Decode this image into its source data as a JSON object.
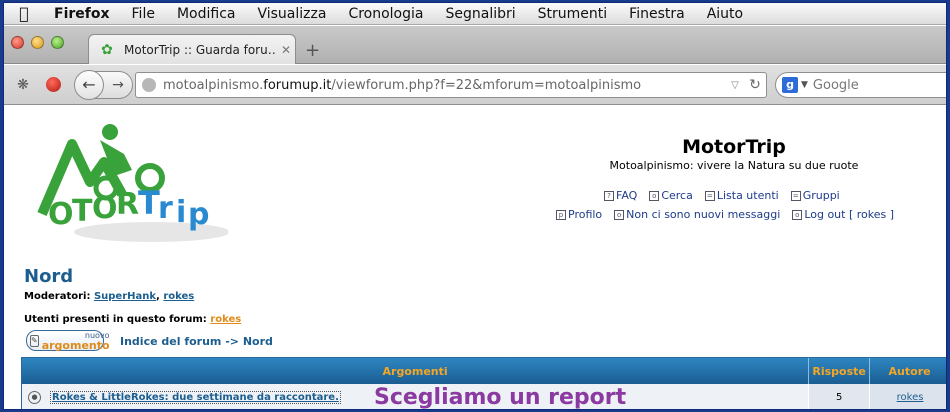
{
  "menubar": {
    "items": [
      "Firefox",
      "File",
      "Modifica",
      "Visualizza",
      "Cronologia",
      "Segnalibri",
      "Strumenti",
      "Finestra",
      "Aiuto"
    ]
  },
  "tab": {
    "title": "MotorTrip :: Guarda foru…",
    "close": "✕",
    "new": "+"
  },
  "nav": {
    "url_prefix": "motoalpinismo.",
    "url_domain": "forumup.it",
    "url_path": "/viewforum.php?f=22&mforum=motoalpinismo",
    "search_placeholder": "Google"
  },
  "site": {
    "title": "MotorTrip",
    "description": "Motoalpinismo: vivere la Natura su due ruote",
    "links_row1": [
      "FAQ",
      "Cerca",
      "Lista utenti",
      "Gruppi"
    ],
    "links_row2": [
      "Profilo",
      "Non ci sono nuovi messaggi",
      "Log out [ rokes ]"
    ]
  },
  "logo": {
    "letters": [
      "O",
      "T",
      "O",
      "R",
      "T",
      "r",
      "i",
      "p"
    ]
  },
  "forum": {
    "title": "Nord",
    "moderators_label": "Moderatori:",
    "moderators": [
      "SuperHank",
      "rokes"
    ],
    "present_label": "Utenti presenti in questo forum:",
    "present_user": "rokes",
    "new_topic_top": "nuovo",
    "new_topic_bottom": "argomento",
    "breadcrumb": "Indice del forum -> Nord"
  },
  "table": {
    "headers": [
      "Argomenti",
      "Risposte",
      "Autore"
    ],
    "rows": [
      {
        "topic": "Rokes & LittleRokes: due settimane da raccontare.",
        "replies": "5",
        "author": "rokes"
      }
    ]
  },
  "overlay_text": "Scegliamo un report",
  "colors": {
    "accent": "#1b5e8f",
    "orange": "#f5a623",
    "logo_green": "#3aa23a",
    "logo_blue": "#2a8ad0"
  }
}
